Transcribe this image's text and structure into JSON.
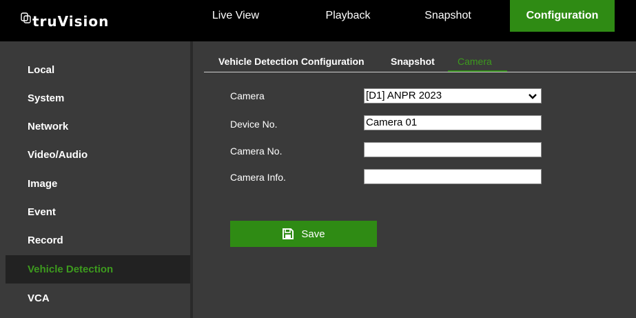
{
  "brand": {
    "name": "truVision",
    "icon": "truvision-logo-icon"
  },
  "nav": {
    "tabs": [
      {
        "label": "Live View",
        "active": false
      },
      {
        "label": "Playback",
        "active": false
      },
      {
        "label": "Snapshot",
        "active": false
      },
      {
        "label": "Configuration",
        "active": true
      }
    ]
  },
  "sidebar": {
    "items": [
      {
        "label": "Local",
        "active": false
      },
      {
        "label": "System",
        "active": false
      },
      {
        "label": "Network",
        "active": false
      },
      {
        "label": "Video/Audio",
        "active": false
      },
      {
        "label": "Image",
        "active": false
      },
      {
        "label": "Event",
        "active": false
      },
      {
        "label": "Record",
        "active": false
      },
      {
        "label": "Vehicle Detection",
        "active": true
      },
      {
        "label": "VCA",
        "active": false
      }
    ]
  },
  "subtabs": {
    "items": [
      {
        "label": "Vehicle Detection Configuration",
        "active": false
      },
      {
        "label": "Snapshot",
        "active": false
      },
      {
        "label": "Camera",
        "active": true
      }
    ]
  },
  "form": {
    "camera_label": "Camera",
    "camera_value": "[D1] ANPR 2023",
    "device_no_label": "Device No.",
    "device_no_value": "Camera 01",
    "camera_no_label": "Camera No.",
    "camera_no_value": "",
    "camera_info_label": "Camera Info.",
    "camera_info_value": ""
  },
  "actions": {
    "save_label": "Save",
    "save_icon": "save-icon"
  },
  "colors": {
    "accent": "#2f8b14",
    "active_text": "#3d9a1e",
    "topbar": "#000000",
    "background": "#3a3a3a"
  }
}
